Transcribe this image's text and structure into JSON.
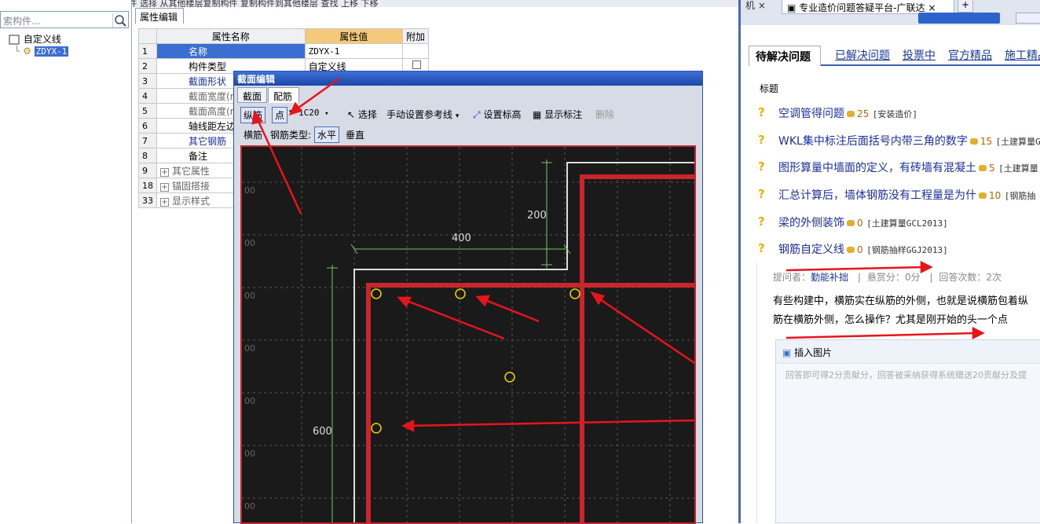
{
  "top_strip": {
    "text": "新建  删除  复制  重命名  楼层  ...  构件  选择  从其他楼层复制构件  复制构件到其他楼层  查找  上移  下移"
  },
  "left": {
    "search_placeholder": "索构件...",
    "tree_root": "自定义线",
    "tree_child": "ZDYX-1"
  },
  "mid": {
    "tab": "属性编辑",
    "headers": [
      "属性名称",
      "属性值",
      "附加"
    ],
    "rows": [
      {
        "n": "1",
        "name": "名称",
        "value": "ZDYX-1"
      },
      {
        "n": "2",
        "name": "构件类型",
        "value": "自定义线"
      },
      {
        "n": "3",
        "name": "截面形状",
        "value": ""
      },
      {
        "n": "4",
        "name": "截面宽度(mm)",
        "value": ""
      },
      {
        "n": "5",
        "name": "截面高度(mm)",
        "value": ""
      },
      {
        "n": "6",
        "name": "轴线距左边线距",
        "value": ""
      },
      {
        "n": "7",
        "name": "其它钢筋",
        "value": ""
      },
      {
        "n": "8",
        "name": "备注",
        "value": ""
      },
      {
        "n": "9",
        "name": "其它属性",
        "value": ""
      },
      {
        "n": "18",
        "name": "锚固搭接",
        "value": ""
      },
      {
        "n": "33",
        "name": "显示样式",
        "value": ""
      }
    ]
  },
  "dialog": {
    "title": "截面编辑",
    "tabs": [
      "截面",
      "配筋"
    ],
    "toolbar": {
      "zongjin": "纵筋",
      "dian": "点",
      "spec": "1C20",
      "select": "选择",
      "manual": "手动设置参考线",
      "set_height": "设置标高",
      "show_label": "显示标注",
      "delete": "删除"
    },
    "toolbar2": {
      "hengjin": "横筋",
      "type_label": "钢筋类型:",
      "horizontal": "水平",
      "vertical": "垂直"
    },
    "dims": {
      "d200": "200",
      "d400": "400",
      "d600": "600"
    },
    "axis_labels": [
      "00",
      "00",
      "00",
      "00",
      "00",
      "00",
      "00",
      "00"
    ]
  },
  "right": {
    "browser_tab": "专业造价问题答疑平台-广联达",
    "tabs": [
      "待解决问题",
      "已解决问题",
      "投票中",
      "官方精品",
      "施工精品"
    ],
    "col_title": "标题",
    "questions": [
      {
        "title": "空调管得问题",
        "coins": "25",
        "tag": "[安装造价]"
      },
      {
        "title": "WKL集中标注后面括号内带三角的数字",
        "coins": "15",
        "tag": "[土建算量G"
      },
      {
        "title": "图形算量中墙面的定义，有砖墙有混凝土",
        "coins": "5",
        "tag": "[土建算量"
      },
      {
        "title": "汇总计算后，墙体钢筋没有工程量是为什",
        "coins": "10",
        "tag": "[钢筋抽"
      },
      {
        "title": "梁的外侧装饰",
        "coins": "0",
        "tag": "[土建算量GCL2013]"
      },
      {
        "title": "钢筋自定义线",
        "coins": "0",
        "tag": "[钢筋抽样GGJ2013]"
      }
    ],
    "asker_label": "提问者：",
    "asker": "勤能补拙",
    "reward": "悬赏分：0分",
    "answers": "回答次数：2次",
    "body_line1": "有些构建中，横筋实在纵筋的外侧，也就是说横筋包着纵",
    "body_line2": "筋在横筋外侧，怎么操作？尤其是刚开始的头一个点",
    "insert_image": "插入图片",
    "hint": "回答即可得2分贡献分，回答被采纳获得系统赠送20贡献分及提"
  }
}
